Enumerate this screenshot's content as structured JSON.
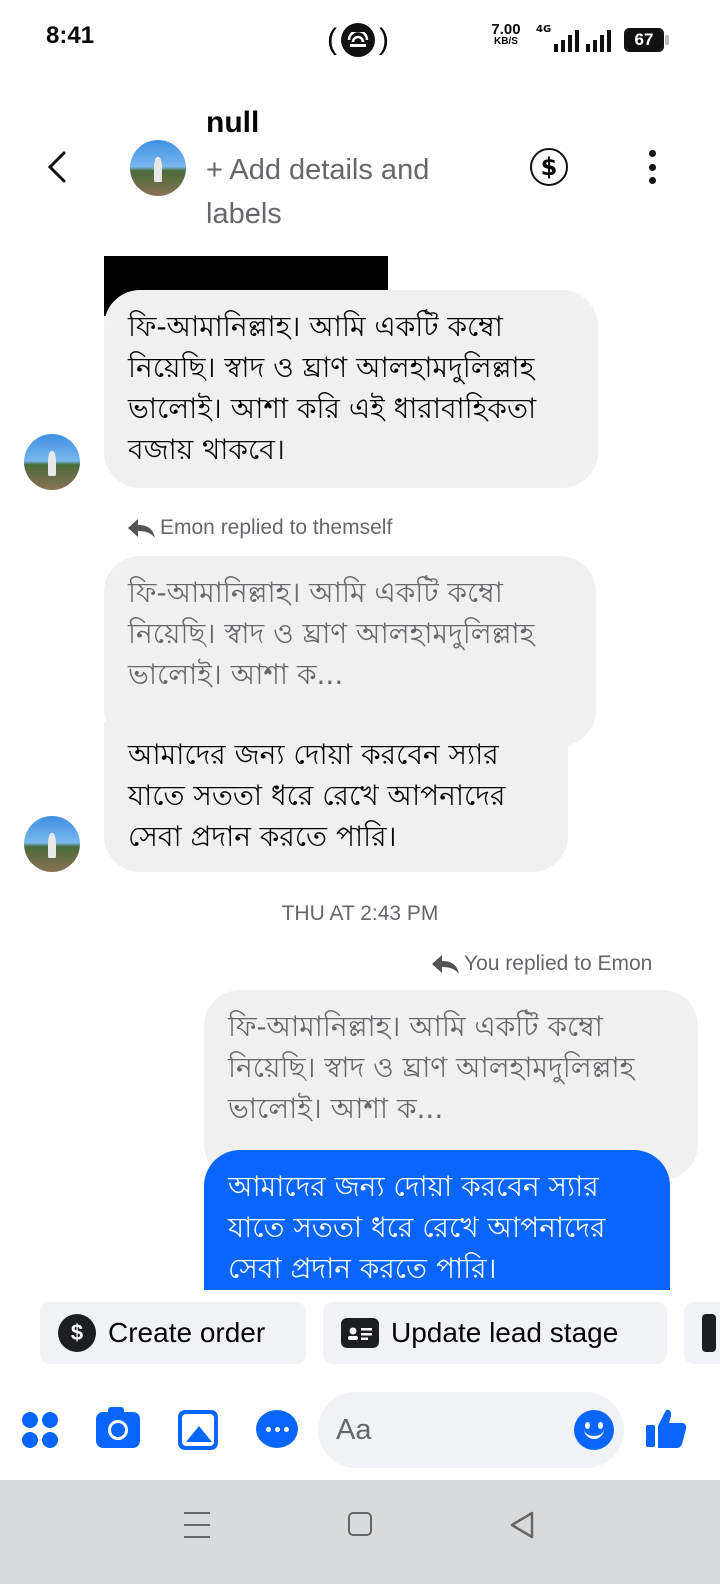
{
  "status_bar": {
    "time": "8:41",
    "hotspot_left": "(",
    "hotspot_right": ")",
    "net_speed_value": "7.00",
    "net_speed_unit": "KB/S",
    "network_type": "4G",
    "battery": "67"
  },
  "header": {
    "name": "null",
    "subtitle": "+ Add details and labels"
  },
  "messages": [
    {
      "sender": "contact",
      "text": "ফি-আমানিল্লাহ। আমি একটি কম্বো নিয়েছি। স্বাদ ও ঘ্রাণ আলহামদুলিল্লাহ ভালোই। আশা করি এই ধারাবাহিকতা বজায় থাকবে।"
    },
    {
      "sender": "contact",
      "reply_label": "Emon replied to themself",
      "quoted": "ফি-আমানিল্লাহ। আমি একটি কম্বো নিয়েছি। স্বাদ ও ঘ্রাণ আলহামদুলিল্লাহ ভালোই। আশা ক...",
      "text": "আমাদের জন্য দোয়া করবেন স্যার যাতে সততা ধরে রেখে আপনাদের সেবা প্রদান করতে পারি।"
    },
    {
      "sender": "me",
      "reply_label": "You replied to Emon",
      "quoted": "ফি-আমানিল্লাহ। আমি একটি কম্বো নিয়েছি। স্বাদ ও ঘ্রাণ আলহামদুলিল্লাহ ভালোই। আশা ক...",
      "text": "আমাদের জন্য দোয়া করবেন স্যার যাতে সততা ধরে রেখে আপনাদের সেবা প্রদান করতে পারি।"
    }
  ],
  "timestamp": "THU AT 2:43 PM",
  "actions": {
    "create_order": "Create order",
    "update_lead_stage": "Update lead stage"
  },
  "composer": {
    "placeholder": "Aa"
  },
  "icons": {
    "back": "chevron-left-icon",
    "dollar": "dollar-circle-icon",
    "more": "more-vertical-icon",
    "reply": "reply-arrow-icon",
    "apps": "apps-grid-icon",
    "camera": "camera-icon",
    "gallery": "gallery-icon",
    "chat": "chat-bubble-icon",
    "emoji": "emoji-icon",
    "like": "thumbs-up-icon"
  },
  "colors": {
    "accent": "#0866ff",
    "bubble_gray": "#f0f0f0",
    "secondary_text": "#65676b"
  }
}
